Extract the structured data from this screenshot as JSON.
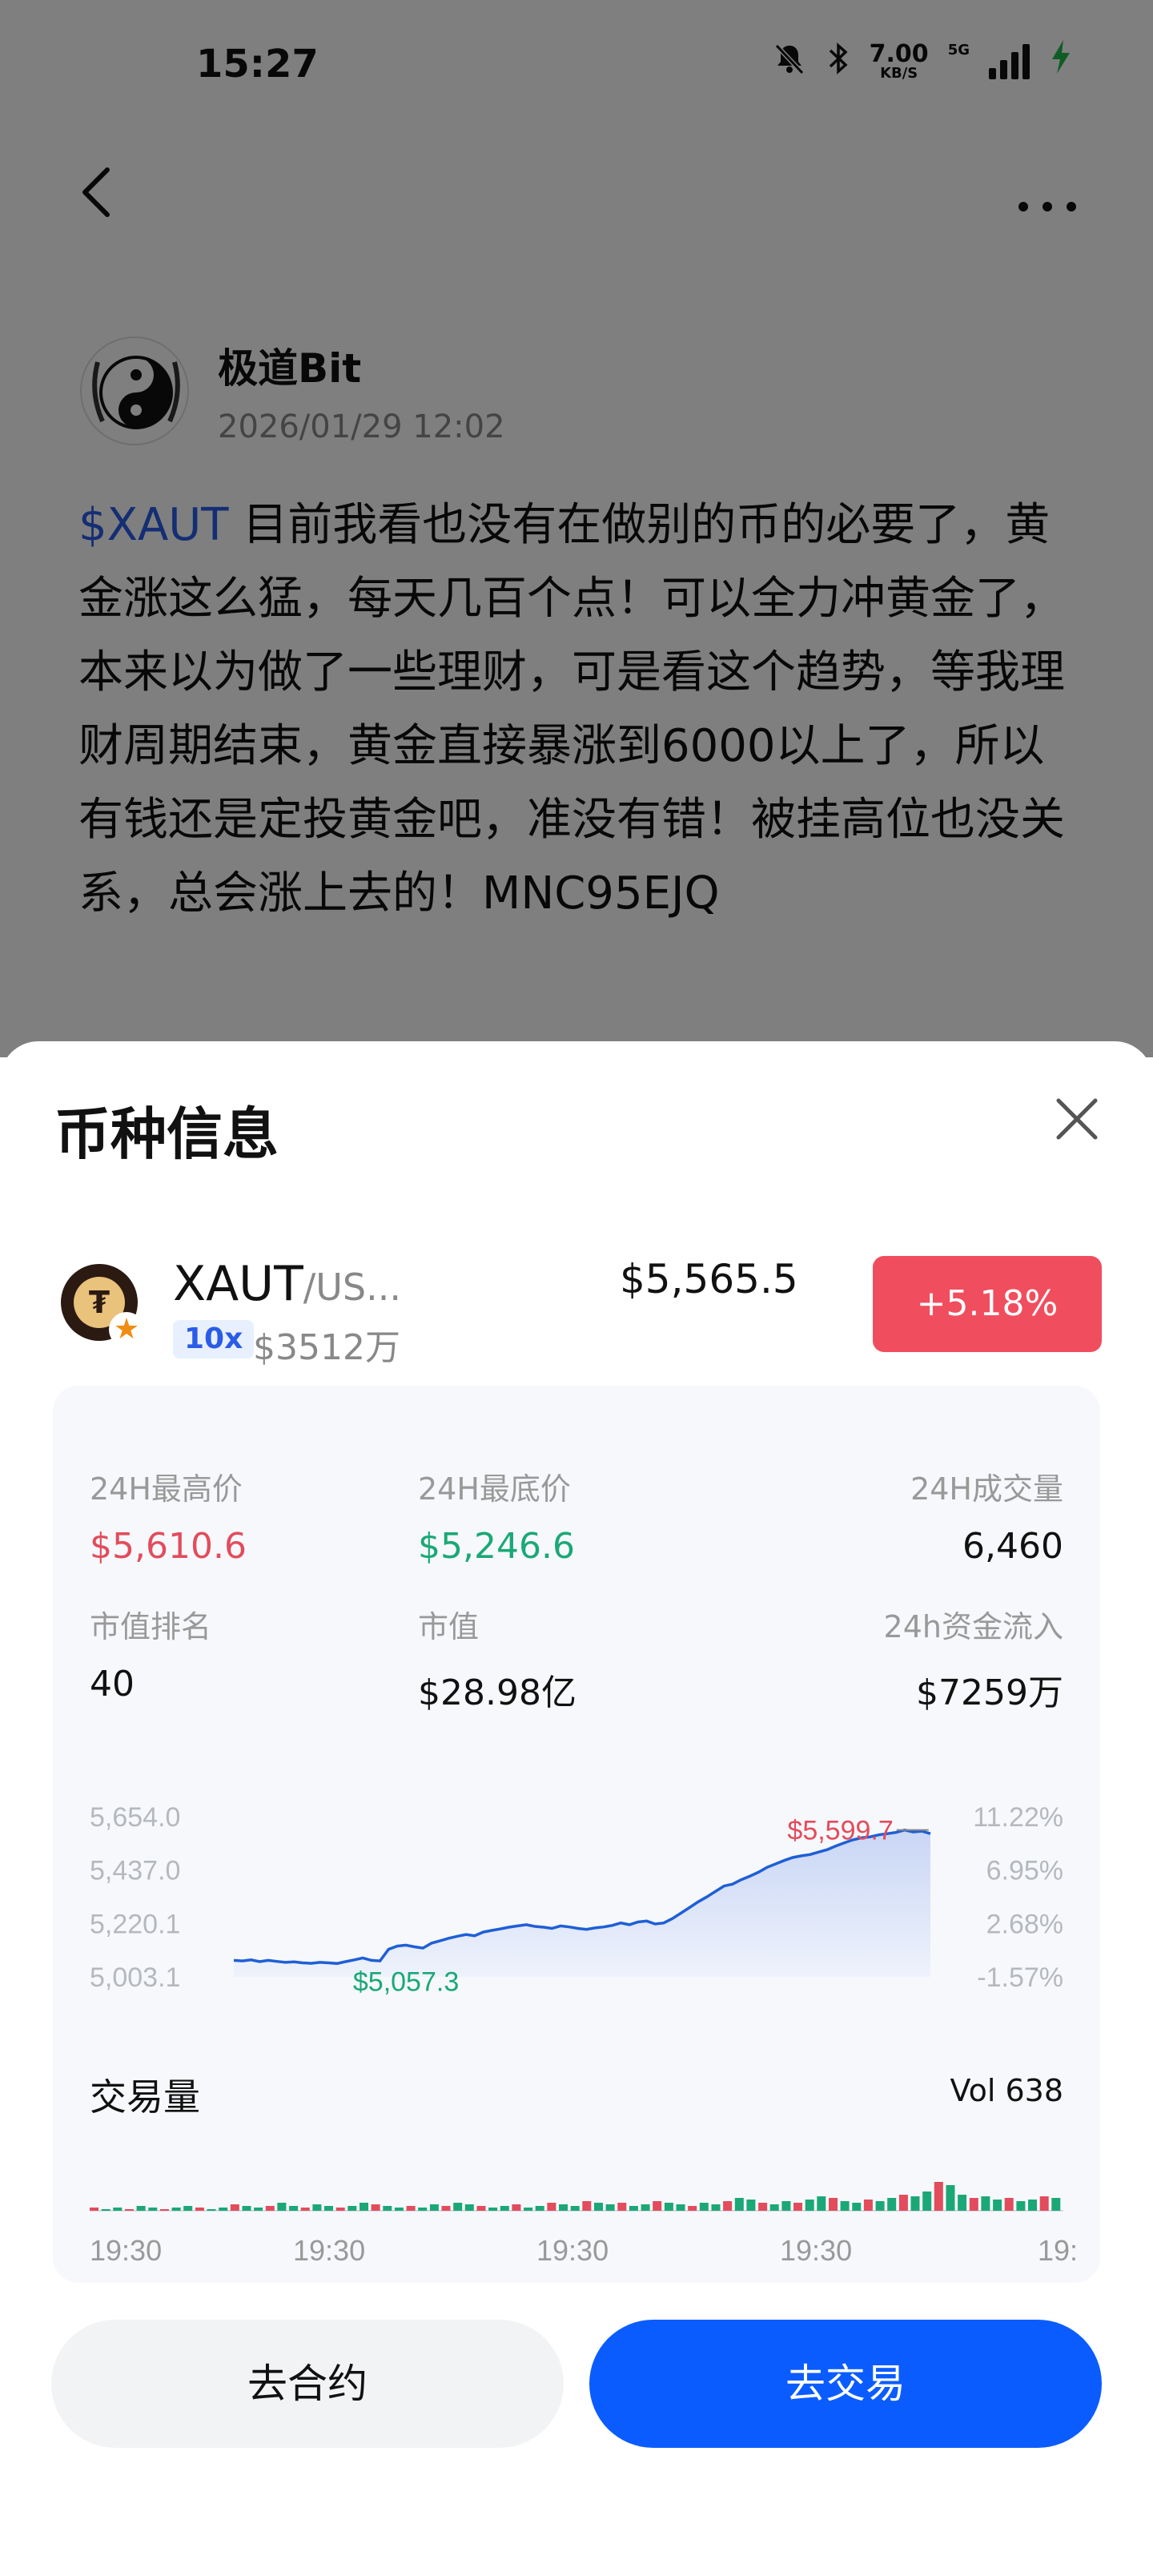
{
  "status_bar": {
    "time": "15:27",
    "net_speed_value": "7.00",
    "net_speed_unit": "KB/S",
    "network": "5G",
    "icons": [
      "mute-bell-icon",
      "bluetooth-icon",
      "signal-icon",
      "charging-icon"
    ]
  },
  "nav": {
    "back_icon": "chevron-left-icon",
    "more_icon": "more-dots-icon"
  },
  "post": {
    "author_name": "极道Bit",
    "author_time": "2026/01/29 12:02",
    "tag": "$XAUT",
    "body": " 目前我看也没有在做别的币的必要了，黄金涨这么猛，每天几百个点！可以全力冲黄金了，本来以为做了一些理财，可是看这个趋势，等我理财周期结束，黄金直接暴涨到6000以上了，所以有钱还是定投黄金吧，准没有错！被挂高位也没关系，总会涨上去的！MNC95EJQ"
  },
  "sheet": {
    "title": "币种信息",
    "close_icon": "close-icon",
    "coin": {
      "name": "XAUT",
      "pair": "/US...",
      "leverage": "10x",
      "market_cap": "$3512万",
      "price": "$5,565.5",
      "change": "+5.18%",
      "change_color": "#f04e5e"
    },
    "stats": {
      "high_label": "24H最高价",
      "high_value": "$5,610.6",
      "low_label": "24H最底价",
      "low_value": "$5,246.6",
      "volume_label": "24H成交量",
      "volume_value": "6,460",
      "rank_label": "市值排名",
      "rank_value": "40",
      "mcap_label": "市值",
      "mcap_value": "$28.98亿",
      "inflow_label": "24h资金流入",
      "inflow_value": "$7259万"
    },
    "volume": {
      "title": "交易量",
      "value": "Vol 638"
    },
    "buttons": {
      "contract": "去合约",
      "trade": "去交易",
      "trade_color": "#0b5cff"
    }
  },
  "chart_data": [
    {
      "type": "line",
      "y_left_ticks": [
        "5,654.0",
        "5,437.0",
        "5,220.1",
        "5,003.1"
      ],
      "y_right_ticks": [
        "11.22%",
        "6.95%",
        "2.68%",
        "-1.57%"
      ],
      "ylim": [
        5003.1,
        5654.0
      ],
      "high_label": "$5,599.7",
      "low_label": "$5,057.3",
      "values": [
        5070,
        5068,
        5072,
        5065,
        5070,
        5066,
        5062,
        5064,
        5060,
        5058,
        5062,
        5060,
        5057.3,
        5065,
        5072,
        5080,
        5070,
        5068,
        5115,
        5128,
        5132,
        5125,
        5120,
        5140,
        5150,
        5160,
        5168,
        5175,
        5170,
        5185,
        5192,
        5198,
        5205,
        5210,
        5215,
        5208,
        5205,
        5200,
        5210,
        5206,
        5200,
        5196,
        5202,
        5206,
        5212,
        5222,
        5215,
        5226,
        5230,
        5218,
        5222,
        5240,
        5262,
        5285,
        5308,
        5328,
        5350,
        5372,
        5380,
        5398,
        5412,
        5428,
        5448,
        5462,
        5476,
        5488,
        5495,
        5500,
        5510,
        5520,
        5535,
        5548,
        5560,
        5568,
        5572,
        5580,
        5585,
        5590,
        5599.7,
        5592,
        5595,
        5585
      ],
      "line_color": "#1f5fd6"
    },
    {
      "type": "bar",
      "x_ticks": [
        "19:30",
        "19:30",
        "19:30",
        "19:30",
        "19:"
      ],
      "values": [
        2,
        1,
        2,
        1,
        3,
        2,
        1,
        2,
        3,
        2,
        1,
        2,
        4,
        3,
        2,
        3,
        5,
        3,
        2,
        4,
        3,
        2,
        3,
        5,
        4,
        3,
        2,
        3,
        2,
        4,
        3,
        5,
        4,
        3,
        2,
        3,
        4,
        2,
        3,
        5,
        4,
        3,
        6,
        5,
        4,
        5,
        3,
        4,
        6,
        5,
        4,
        3,
        5,
        4,
        6,
        8,
        7,
        5,
        4,
        6,
        5,
        7,
        9,
        8,
        6,
        5,
        7,
        6,
        8,
        10,
        9,
        12,
        18,
        16,
        10,
        8,
        9,
        7,
        8,
        6,
        7,
        9,
        8
      ],
      "colors": [
        "#1ba876",
        "#e24c5c"
      ]
    }
  ]
}
